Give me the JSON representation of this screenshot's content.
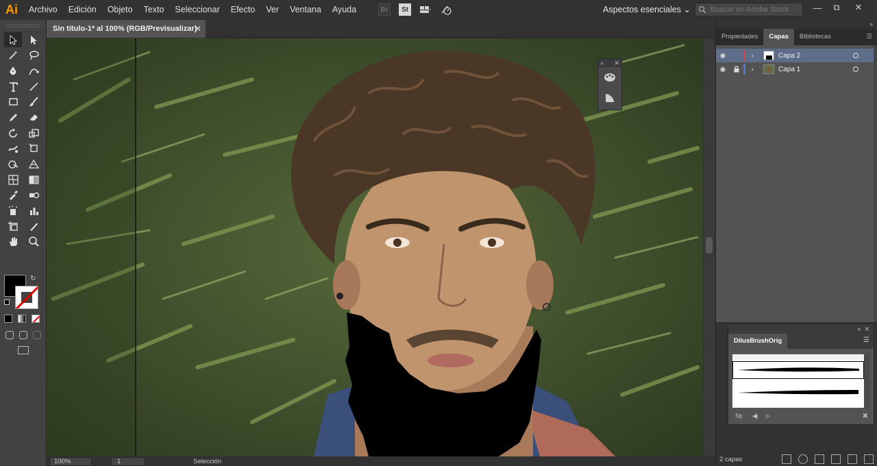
{
  "app": {
    "logo": "Ai",
    "menu": [
      "Archivo",
      "Edición",
      "Objeto",
      "Texto",
      "Seleccionar",
      "Efecto",
      "Ver",
      "Ventana",
      "Ayuda"
    ],
    "bridge_label": "Br",
    "stock_label": "St",
    "workspace": "Aspectos esenciales",
    "search_placeholder": "Buscar en Adobe Stock"
  },
  "document": {
    "tab_title": "Sin título-1* al 100% (RGB/Previsualizar)"
  },
  "statusbar": {
    "zoom": "100%",
    "page": "1",
    "tool_status": "Selección"
  },
  "panels": {
    "tabs": [
      "Propiedades",
      "Capas",
      "Bibliotecas"
    ],
    "active_tab": "Capas",
    "layers": [
      {
        "name": "Capa 2",
        "color": "#e04040",
        "selected": true,
        "locked": false
      },
      {
        "name": "Capa 1",
        "color": "#4a7ad6",
        "selected": false,
        "locked": true
      }
    ],
    "layers_count": "2 capas",
    "brush_library": "DilusBrushOrig"
  },
  "colors": {
    "fill": "#000000",
    "stroke": "none",
    "accent": "#ff9a00",
    "selection": "#5e6d89"
  },
  "tool_icons": [
    [
      "selection-icon",
      "direct-selection-icon"
    ],
    [
      "magic-wand-icon",
      "lasso-icon"
    ],
    [
      "pen-icon",
      "curvature-icon"
    ],
    [
      "type-icon",
      "line-segment-icon"
    ],
    [
      "rectangle-icon",
      "paintbrush-icon"
    ],
    [
      "pencil-icon",
      "eraser-icon"
    ],
    [
      "rotate-icon",
      "scale-icon"
    ],
    [
      "warp-icon",
      "free-transform-icon"
    ],
    [
      "shape-builder-icon",
      "perspective-grid-icon"
    ],
    [
      "mesh-icon",
      "gradient-icon"
    ],
    [
      "eyedropper-icon",
      "blend-icon"
    ],
    [
      "symbol-sprayer-icon",
      "column-graph-icon"
    ],
    [
      "artboard-icon",
      "slice-icon"
    ],
    [
      "hand-icon",
      "zoom-icon"
    ]
  ]
}
